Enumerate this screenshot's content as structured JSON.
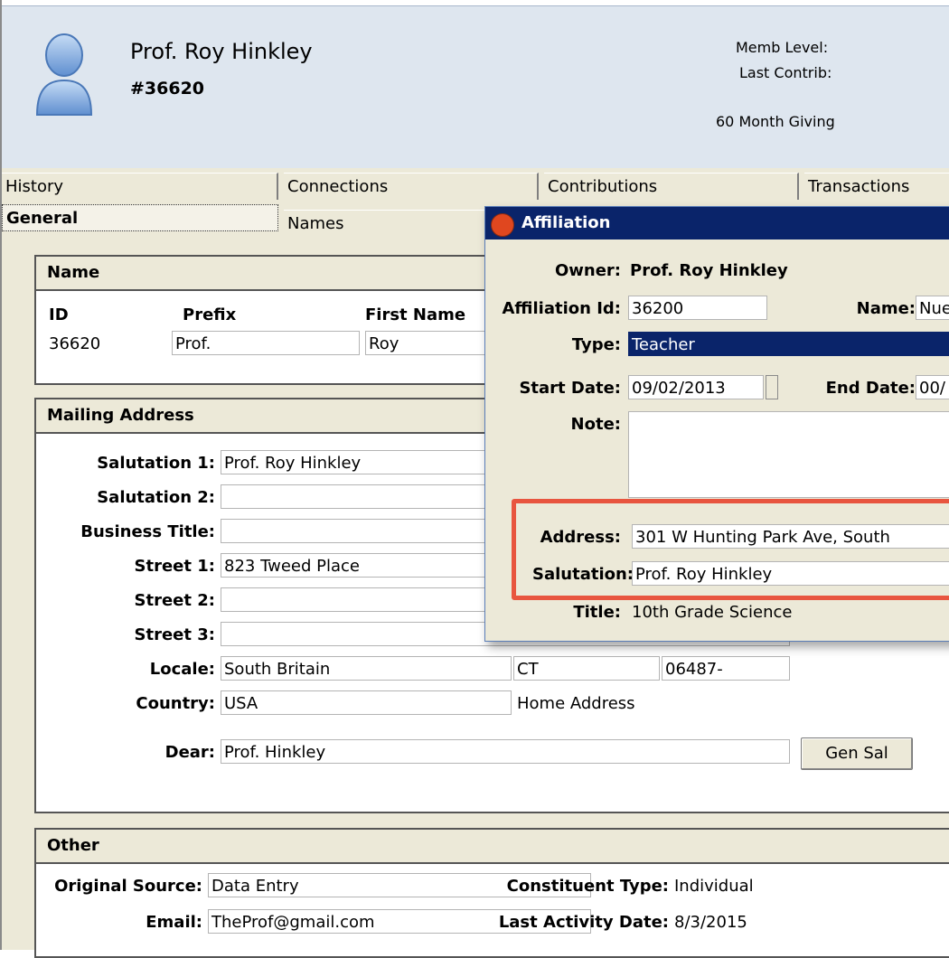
{
  "constituent": {
    "name": "Prof. Roy Hinkley",
    "number": "#36620",
    "memb_level_label": "Memb Level:",
    "last_contrib_label": "Last Contrib:",
    "giving_label": "60 Month Giving"
  },
  "tabs": {
    "history": "History",
    "connections": "Connections",
    "contributions": "Contributions",
    "transactions": "Transactions",
    "general": "General",
    "names": "Names"
  },
  "name_panel": {
    "title": "Name",
    "id_label": "ID",
    "prefix_label": "Prefix",
    "first_name_label": "First Name",
    "id_value": "36620",
    "prefix_value": "Prof.",
    "first_name_value": "Roy"
  },
  "mailing": {
    "title": "Mailing Address",
    "salutation1_label": "Salutation 1:",
    "salutation1_value": "Prof. Roy Hinkley",
    "salutation2_label": "Salutation 2:",
    "salutation2_value": "",
    "business_title_label": "Business Title:",
    "business_title_value": "",
    "street1_label": "Street 1:",
    "street1_value": "823 Tweed Place",
    "street2_label": "Street 2:",
    "street2_value": "",
    "street3_label": "Street 3:",
    "street3_value": "",
    "locale_label": "Locale:",
    "locale_city": "South Britain",
    "locale_state": "CT",
    "locale_zip": "06487-",
    "country_label": "Country:",
    "country_value": "USA",
    "address_type": "Home Address",
    "dear_label": "Dear:",
    "dear_value": "Prof. Hinkley",
    "gen_sal_button": "Gen Sal"
  },
  "other": {
    "title": "Other",
    "original_source_label": "Original Source:",
    "original_source_value": "Data Entry",
    "email_label": "Email:",
    "email_value": "TheProf@gmail.com",
    "constituent_type_label": "Constituent Type:",
    "constituent_type_value": "Individual",
    "last_activity_label": "Last Activity Date:",
    "last_activity_value": "8/3/2015"
  },
  "affiliation": {
    "title": "Affiliation",
    "owner_label": "Owner:",
    "owner_value": "Prof. Roy Hinkley",
    "affiliation_id_label": "Affiliation Id:",
    "affiliation_id_value": "36200",
    "name_label": "Name:",
    "name_value": "Nue",
    "type_label": "Type:",
    "type_value": "Teacher",
    "start_date_label": "Start Date:",
    "start_date_value": "09/02/2013",
    "end_date_label": "End Date:",
    "end_date_value": "00/",
    "note_label": "Note:",
    "note_value": "",
    "address_label": "Address:",
    "address_value": "301 W Hunting Park Ave, South",
    "salutation_label": "Salutation:",
    "salutation_value": "Prof. Roy Hinkley",
    "title_label": "Title:",
    "title_value": "10th Grade Science"
  },
  "colors": {
    "header_bg": "#dee6ef",
    "dialog_title_bg": "#0a246a",
    "highlight": "#e8553f",
    "selected_bg": "#0a246a"
  }
}
